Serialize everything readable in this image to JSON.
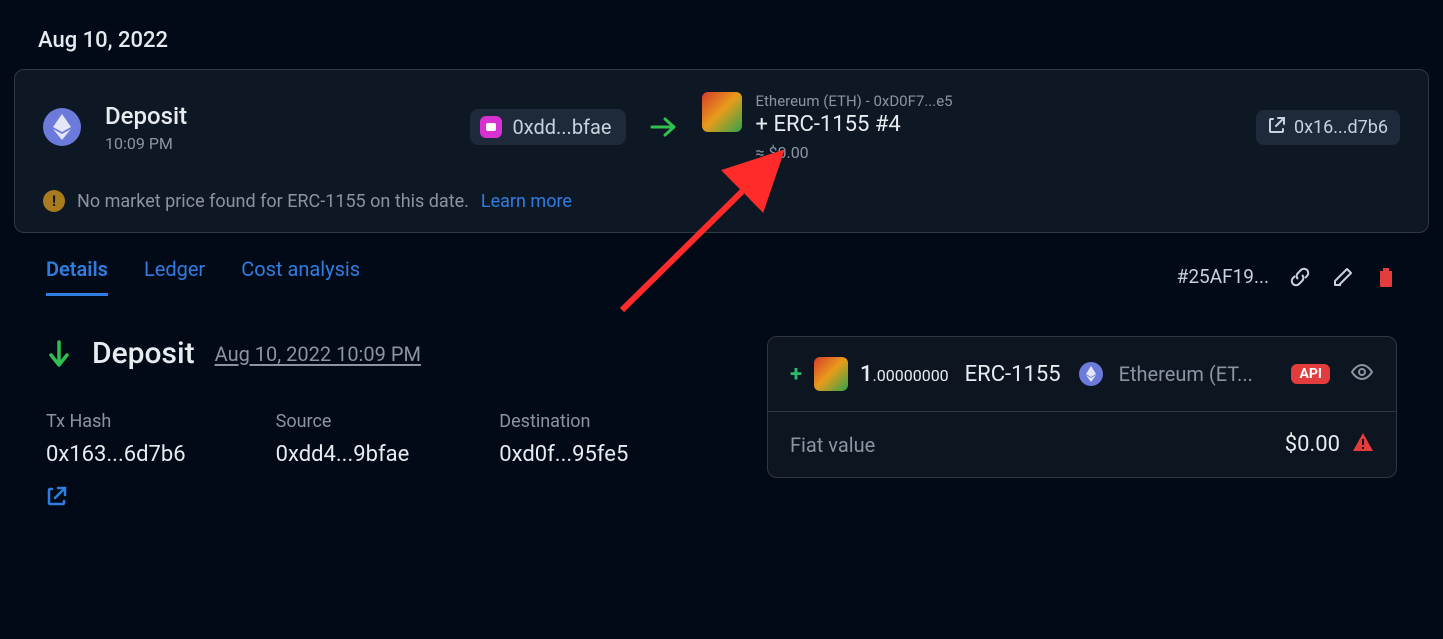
{
  "date_header": "Aug 10, 2022",
  "tx": {
    "title": "Deposit",
    "time": "10:09 PM",
    "source_addr": "0xdd...bfae",
    "network_line": "Ethereum (ETH) - 0xD0F7...e5",
    "asset_main": "+ ERC-1155 #4",
    "asset_approx": "≈ $0.00",
    "ext_hash_short": "0x16...d7b6"
  },
  "warning": {
    "text": "No market price found for ERC-1155 on this date.",
    "learn_more": "Learn more"
  },
  "tabs": {
    "details": "Details",
    "ledger": "Ledger",
    "cost": "Cost analysis"
  },
  "actions": {
    "tx_id": "#25AF19..."
  },
  "deposit": {
    "title": "Deposit",
    "timestamp": "Aug 10, 2022 10:09 PM"
  },
  "meta": {
    "txhash_label": "Tx Hash",
    "txhash_val": "0x163...6d7b6",
    "source_label": "Source",
    "source_val": "0xdd4...9bfae",
    "dest_label": "Destination",
    "dest_val": "0xd0f...95fe5"
  },
  "asset_box": {
    "amount_int": "1",
    "amount_dec": ".00000000",
    "symbol": "ERC-1155",
    "network": "Ethereum (ET...",
    "api_badge": "API",
    "fiat_label": "Fiat value",
    "fiat_value": "$0.00"
  }
}
